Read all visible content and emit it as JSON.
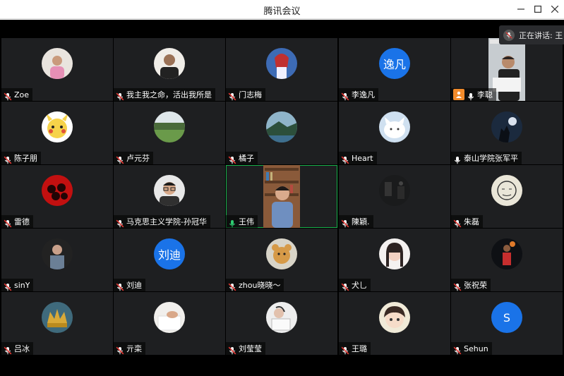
{
  "window": {
    "title": "腾讯会议"
  },
  "speaking": {
    "label": "正在讲话: 王"
  },
  "participants": [
    {
      "name": "Zoe",
      "mic": "muted",
      "avatar": "photo-child-pink"
    },
    {
      "name": "我主我之命，活出我所是",
      "mic": "muted",
      "avatar": "photo-man-desk"
    },
    {
      "name": "门志梅",
      "mic": "muted",
      "avatar": "photo-anime-girl"
    },
    {
      "name": "李逸凡",
      "mic": "muted",
      "avatar_text": "逸凡",
      "avatar_color": "#1a73e8"
    },
    {
      "name": "李聪",
      "mic": "on",
      "host": true,
      "avatar": "video-man-reading"
    },
    {
      "name": "陈子朋",
      "mic": "muted",
      "avatar": "photo-pikachu"
    },
    {
      "name": "卢元芬",
      "mic": "muted",
      "avatar": "photo-garden"
    },
    {
      "name": "橘子",
      "mic": "muted",
      "avatar": "photo-seaside"
    },
    {
      "name": "Heart",
      "mic": "muted",
      "avatar": "photo-cartoon-cat"
    },
    {
      "name": "泰山学院张军平",
      "mic": "on",
      "avatar": "photo-wolf"
    },
    {
      "name": "雷德",
      "mic": "muted",
      "avatar": "photo-red-portraits"
    },
    {
      "name": "马克思主义学院-孙冠华",
      "mic": "muted",
      "avatar": "photo-man-glasses"
    },
    {
      "name": "王伟",
      "mic": "on-active",
      "avatar": "video-man-bookshelf",
      "active": true
    },
    {
      "name": "陳穎.",
      "mic": "muted",
      "avatar": "photo-dark-room"
    },
    {
      "name": "朱磊",
      "mic": "muted",
      "avatar": "photo-sketch-face"
    },
    {
      "name": "sinY",
      "mic": "muted",
      "avatar": "photo-girl-dark"
    },
    {
      "name": "刘迪",
      "mic": "muted",
      "avatar_text": "刘迪",
      "avatar_color": "#1a73e8"
    },
    {
      "name": "zhou晓晓～",
      "mic": "muted",
      "avatar": "photo-teddy-bear"
    },
    {
      "name": "犬乚",
      "mic": "muted",
      "avatar": "photo-girl-cute"
    },
    {
      "name": "张祝荣",
      "mic": "muted",
      "avatar": "photo-basketball"
    },
    {
      "name": "吕冰",
      "mic": "muted",
      "avatar": "photo-crown"
    },
    {
      "name": "亓栾",
      "mic": "muted",
      "avatar": "photo-hand-writing"
    },
    {
      "name": "刘莹莹",
      "mic": "muted",
      "avatar": "photo-girl-reading"
    },
    {
      "name": "王璐",
      "mic": "muted",
      "avatar": "photo-anime-face"
    },
    {
      "name": "Sehun",
      "mic": "muted",
      "avatar_text": "S",
      "avatar_color": "#1a73e8"
    }
  ],
  "icons": {
    "mic_muted": "mic-muted-icon",
    "mic_on": "mic-icon",
    "host": "host-icon",
    "minimize": "minimize-icon",
    "maximize": "maximize-icon",
    "close": "close-icon"
  }
}
